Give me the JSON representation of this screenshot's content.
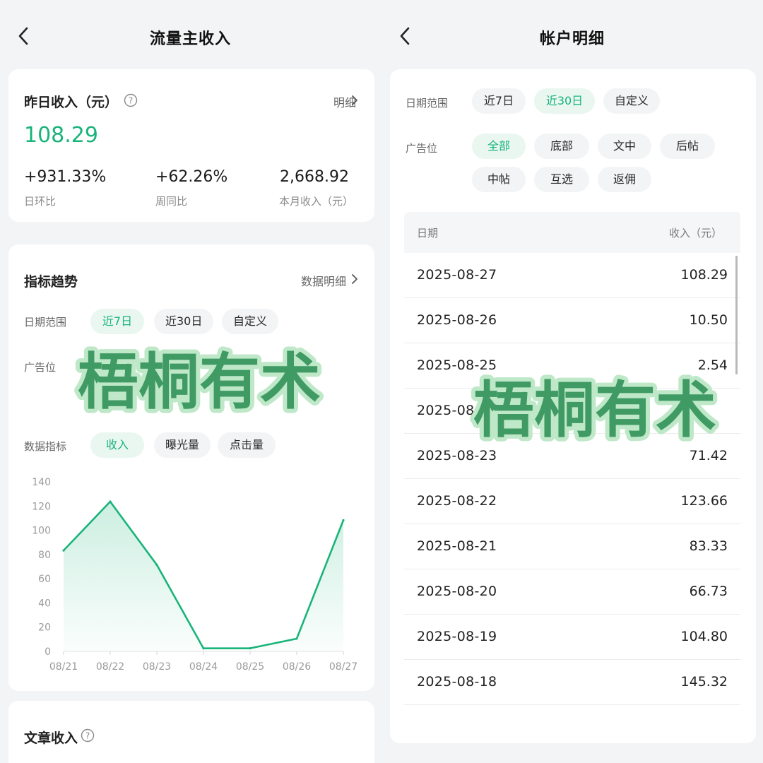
{
  "left": {
    "title": "流量主收入",
    "summary": {
      "label": "昨日收入（元）",
      "detail_link": "明细",
      "value": "108.29",
      "stats": [
        {
          "value": "+931.33%",
          "label": "日环比"
        },
        {
          "value": "+62.26%",
          "label": "周同比"
        },
        {
          "value": "2,668.92",
          "label": "本月收入（元）"
        }
      ]
    },
    "trend": {
      "title": "指标趋势",
      "detail_link": "数据明细",
      "date_range_label": "日期范围",
      "date_options": [
        "近7日",
        "近30日",
        "自定义"
      ],
      "ad_slot_label": "广告位",
      "metric_label": "数据指标",
      "metric_options": [
        "收入",
        "曝光量",
        "点击量"
      ]
    },
    "article_income": {
      "title": "文章收入"
    }
  },
  "right": {
    "title": "帐户明细",
    "date_range_label": "日期范围",
    "date_options": [
      "近7日",
      "近30日",
      "自定义"
    ],
    "ad_slot_label": "广告位",
    "ad_slot_options": [
      "全部",
      "底部",
      "文中",
      "后帖",
      "中帖",
      "互选",
      "返佣"
    ],
    "table": {
      "headers": [
        "日期",
        "收入（元）"
      ],
      "rows": [
        {
          "date": "2025-08-27",
          "value": "108.29"
        },
        {
          "date": "2025-08-26",
          "value": "10.50"
        },
        {
          "date": "2025-08-25",
          "value": "2.54"
        },
        {
          "date": "2025-08-24",
          "value": ""
        },
        {
          "date": "2025-08-23",
          "value": "71.42"
        },
        {
          "date": "2025-08-22",
          "value": "123.66"
        },
        {
          "date": "2025-08-21",
          "value": "83.33"
        },
        {
          "date": "2025-08-20",
          "value": "66.73"
        },
        {
          "date": "2025-08-19",
          "value": "104.80"
        },
        {
          "date": "2025-08-18",
          "value": "145.32"
        }
      ]
    }
  },
  "watermark": "梧桐有术",
  "colors": {
    "accent": "#19b47a",
    "watermark": "#3f9a63",
    "watermark_outline": "#bfe8c9"
  },
  "chart_data": {
    "type": "area",
    "categories": [
      "08/21",
      "08/22",
      "08/23",
      "08/24",
      "08/25",
      "08/26",
      "08/27"
    ],
    "series": [
      {
        "values": [
          83.33,
          123.66,
          71.42,
          2.5,
          2.54,
          10.5,
          108.29
        ]
      }
    ],
    "ylim": [
      0,
      140
    ],
    "yticks": [
      0,
      20,
      40,
      60,
      80,
      100,
      120,
      140
    ],
    "grid": false
  }
}
